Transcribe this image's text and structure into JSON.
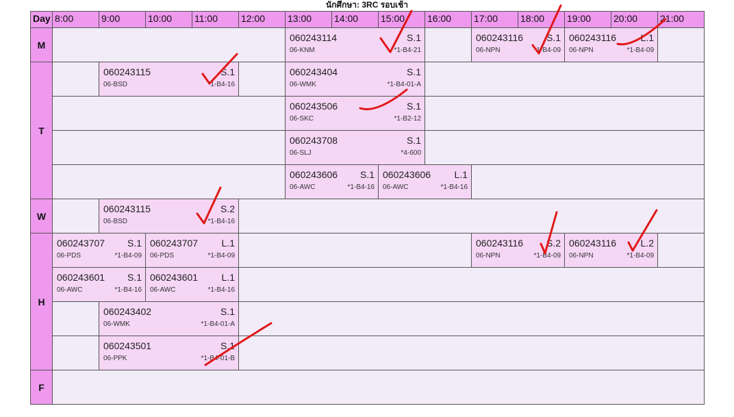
{
  "page_title": "นักศึกษา: 3RC รอบเช้า",
  "day_header": "Day",
  "hours": [
    "8:00",
    "9:00",
    "10:00",
    "11:00",
    "12:00",
    "13:00",
    "14:00",
    "15:00",
    "16:00",
    "17:00",
    "18:00",
    "19:00",
    "20:00",
    "21:00"
  ],
  "days": [
    {
      "label": "M",
      "rows": [
        [
          {
            "code": "060243114",
            "sec": "S.1",
            "teacher": "06-KNM",
            "room": "*1-B4-21",
            "start": 13,
            "end": 16
          },
          {
            "code": "060243116",
            "sec": "S.1",
            "teacher": "06-NPN",
            "room": "*1-B4-09",
            "start": 17,
            "end": 19
          },
          {
            "code": "060243116",
            "sec": "L.1",
            "teacher": "06-NPN",
            "room": "*1-B4-09",
            "start": 19,
            "end": 21
          }
        ]
      ]
    },
    {
      "label": "T",
      "rows": [
        [
          {
            "code": "060243115",
            "sec": "S.1",
            "teacher": "06-BSD",
            "room": "*1-B4-16",
            "start": 9,
            "end": 12
          },
          {
            "code": "060243404",
            "sec": "S.1",
            "teacher": "06-WMK",
            "room": "*1-B4-01-A",
            "start": 13,
            "end": 16
          }
        ],
        [
          {
            "code": "060243506",
            "sec": "S.1",
            "teacher": "06-SKC",
            "room": "*1-B2-12",
            "start": 13,
            "end": 16
          }
        ],
        [
          {
            "code": "060243708",
            "sec": "S.1",
            "teacher": "06-SLJ",
            "room": "*4-600",
            "start": 13,
            "end": 16
          }
        ],
        [
          {
            "code": "060243606",
            "sec": "S.1",
            "teacher": "06-AWC",
            "room": "*1-B4-16",
            "start": 13,
            "end": 15
          },
          {
            "code": "060243606",
            "sec": "L.1",
            "teacher": "06-AWC",
            "room": "*1-B4-16",
            "start": 15,
            "end": 17
          }
        ]
      ]
    },
    {
      "label": "W",
      "rows": [
        [
          {
            "code": "060243115",
            "sec": "S.2",
            "teacher": "06-BSD",
            "room": "*1-B4-16",
            "start": 9,
            "end": 12
          }
        ]
      ]
    },
    {
      "label": "H",
      "rows": [
        [
          {
            "code": "060243707",
            "sec": "S.1",
            "teacher": "06-PDS",
            "room": "*1-B4-09",
            "start": 8,
            "end": 10
          },
          {
            "code": "060243707",
            "sec": "L.1",
            "teacher": "06-PDS",
            "room": "*1-B4-09",
            "start": 10,
            "end": 12
          },
          {
            "code": "060243116",
            "sec": "S.2",
            "teacher": "06-NPN",
            "room": "*1-B4-09",
            "start": 17,
            "end": 19
          },
          {
            "code": "060243116",
            "sec": "L.2",
            "teacher": "06-NPN",
            "room": "*1-B4-09",
            "start": 19,
            "end": 21
          }
        ],
        [
          {
            "code": "060243601",
            "sec": "S.1",
            "teacher": "06-AWC",
            "room": "*1-B4-16",
            "start": 8,
            "end": 10
          },
          {
            "code": "060243601",
            "sec": "L.1",
            "teacher": "06-AWC",
            "room": "*1-B4-16",
            "start": 10,
            "end": 12
          }
        ],
        [
          {
            "code": "060243402",
            "sec": "S.1",
            "teacher": "06-WMK",
            "room": "*1-B4-01-A",
            "start": 9,
            "end": 12
          }
        ],
        [
          {
            "code": "060243501",
            "sec": "S.1",
            "teacher": "06-PPK",
            "room": "*1-B4-01-B",
            "start": 9,
            "end": 12
          }
        ]
      ]
    },
    {
      "label": "F",
      "rows": [
        []
      ]
    }
  ],
  "colors": {
    "header": "#ee99ee",
    "event": "#f5d6f5",
    "empty": "#f1ecf7",
    "grid_border": "#555555",
    "check_mark": "#e01818"
  }
}
